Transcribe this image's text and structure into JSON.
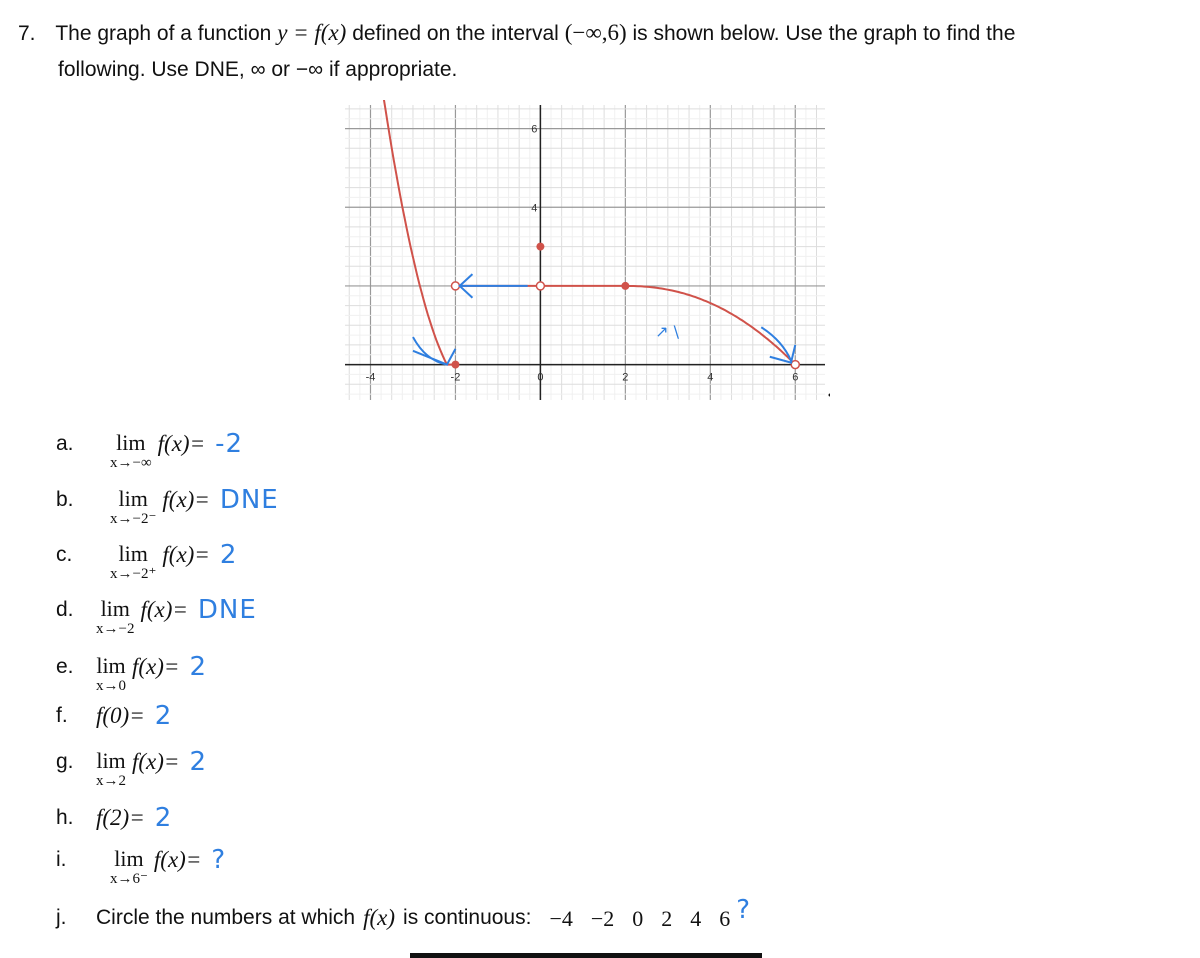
{
  "question": {
    "number": "7.",
    "line1_a": "The graph of a function",
    "line1_fn": "y = f(x)",
    "line1_b": "defined on the interval",
    "line1_interval": "(−∞,6)",
    "line1_c": "is shown below. Use the graph to find the",
    "line2": "following. Use DNE, ∞ or −∞ if appropriate."
  },
  "items": [
    {
      "label": "a.",
      "lim": "lim",
      "sub": "x→−∞",
      "expr": "f(x)=",
      "answer": "-2"
    },
    {
      "label": "b.",
      "lim": "lim",
      "sub": "x→−2⁻",
      "expr": "f(x)=",
      "answer": "DNE"
    },
    {
      "label": "c.",
      "lim": "lim",
      "sub": "x→−2⁺",
      "expr": "f(x)=",
      "answer": "2"
    },
    {
      "label": "d.",
      "lim": "lim",
      "sub": "x→−2",
      "expr": "f(x)=",
      "answer": "DNE"
    },
    {
      "label": "e.",
      "lim": "lim",
      "sub": "x→0",
      "expr": "f(x)=",
      "answer": "2"
    },
    {
      "label": "f.",
      "lim": "",
      "sub": "",
      "expr": "f(0)=",
      "answer": "2"
    },
    {
      "label": "g.",
      "lim": "lim",
      "sub": "x→2",
      "expr": "f(x)=",
      "answer": "2"
    },
    {
      "label": "h.",
      "lim": "",
      "sub": "",
      "expr": "f(2)=",
      "answer": "2"
    },
    {
      "label": "i.",
      "lim": "lim",
      "sub": "x→6⁻",
      "expr": "f(x)=",
      "answer": "?"
    }
  ],
  "item_j": {
    "label": "j.",
    "text_a": "Circle the numbers at which",
    "fn": "f(x)",
    "text_b": "is continuous:",
    "numbers": [
      "−4",
      "−2",
      "0",
      "2",
      "4",
      "6"
    ],
    "answer": "?"
  },
  "graph": {
    "xlim": [
      -4.6,
      6.7
    ],
    "ylim": [
      -0.9,
      6.6
    ],
    "x_ticks": [
      "-4",
      "-2",
      "0",
      "2",
      "4",
      "6"
    ],
    "y_ticks": [
      "4",
      "6"
    ],
    "y_tick_partial": "2",
    "curve_color": "#d0524a",
    "annotation_color": "#2f7fe0",
    "annotation_text": "↗ \\",
    "closed_points": [
      [
        -2,
        0
      ],
      [
        0,
        3
      ],
      [
        2,
        2
      ]
    ],
    "open_points": [
      [
        -2,
        2
      ],
      [
        0,
        2
      ],
      [
        6,
        0
      ]
    ]
  }
}
